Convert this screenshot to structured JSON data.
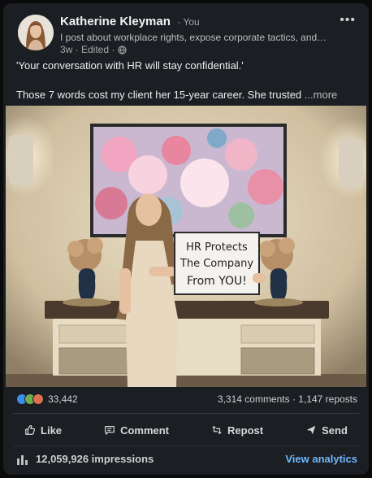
{
  "post": {
    "author_name": "Katherine Kleyman",
    "author_badge": "· You",
    "headline": "I post about workplace rights, expose corporate tactics, and gui...",
    "meta": "3w · Edited ·",
    "text_line1": "'Your conversation with HR will stay confidential.'",
    "text_line2": "Those 7 words cost my client her 15-year career. She trusted",
    "see_more": "...more",
    "sign_text_line1": "HR Protects",
    "sign_text_line2": "The Company",
    "sign_text_line3": "From YOU!"
  },
  "social": {
    "reactions_count": "33,442",
    "comments_reposts": "3,314 comments · 1,147 reposts"
  },
  "actions": {
    "like": "Like",
    "comment": "Comment",
    "repost": "Repost",
    "send": "Send"
  },
  "analytics": {
    "impressions": "12,059,926 impressions",
    "view_analytics": "View analytics"
  },
  "colors": {
    "card_bg": "#1b1f23",
    "link_blue": "#71b7fb",
    "like_blue": "#378fe9",
    "celebrate_green": "#6dae4f",
    "love_red": "#df704d"
  }
}
